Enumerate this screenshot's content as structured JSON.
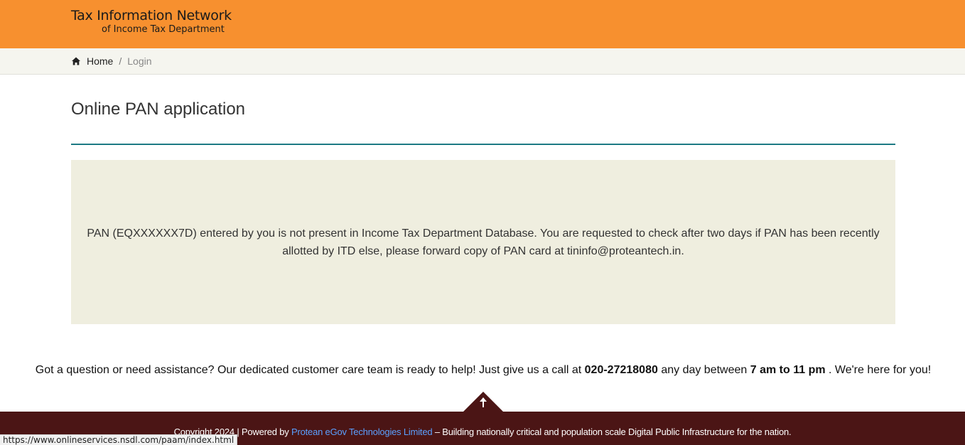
{
  "header": {
    "logo_line1": "Tax Information Network",
    "logo_line2": "of Income Tax Department"
  },
  "breadcrumb": {
    "home_icon": "home-icon",
    "home_label": "Home",
    "separator": "/",
    "current_label": "Login"
  },
  "main": {
    "title": "Online PAN application",
    "message": "PAN (EQXXXXXX7D) entered by you is not present in Income Tax Department Database. You are requested to check after two days if PAN has been recently allotted by ITD else, please forward copy of PAN card at tininfo@proteantech.in."
  },
  "help": {
    "text_before": "Got a question or need assistance? Our dedicated customer care team is ready to help! Just give us a call at ",
    "phone": "020-27218080",
    "text_middle": " any day between ",
    "hours": "7 am to 11 pm",
    "text_after": " . We're here for you!"
  },
  "footer": {
    "text_before": "Copyright 2024 | Powered by ",
    "link_text": "Protean eGov Technologies Limited",
    "text_after": " – Building nationally critical and population scale Digital Public Infrastructure for the nation.",
    "scroll_top_icon": "arrow-up-icon"
  },
  "status_bar": {
    "url": "https://www.onlineservices.nsdl.com/paam/index.html"
  },
  "colors": {
    "header": "#f7902f",
    "crumb_bar": "#f5f5ef",
    "rule": "#1d7a84",
    "message_bg": "#efeedf",
    "footer": "#4b1515",
    "link": "#5aa0ff"
  }
}
